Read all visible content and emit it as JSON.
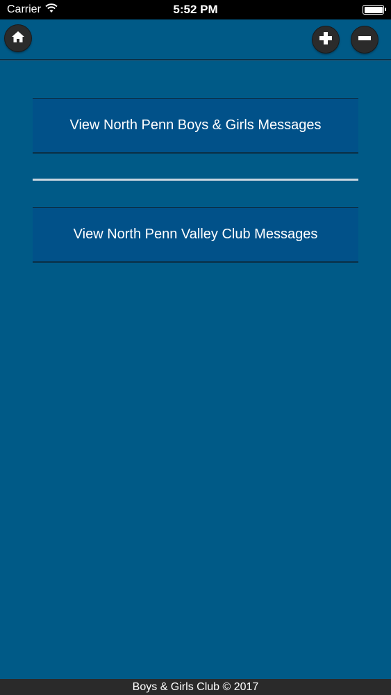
{
  "status_bar": {
    "carrier": "Carrier",
    "time": "5:52 PM",
    "icons": [
      "wifi-icon",
      "battery-icon"
    ]
  },
  "nav": {
    "icons": [
      "home-icon",
      "plus-icon",
      "minus-icon"
    ]
  },
  "messages": {
    "button_1_label": "View North Penn Boys & Girls Messages",
    "button_2_label": "View North Penn Valley Club Messages"
  },
  "footer": {
    "text": "Boys & Girls Club © 2017"
  },
  "colors": {
    "background": "#005a87",
    "button": "#015189",
    "status_bar": "#000000",
    "footer": "#2a2a2a"
  }
}
